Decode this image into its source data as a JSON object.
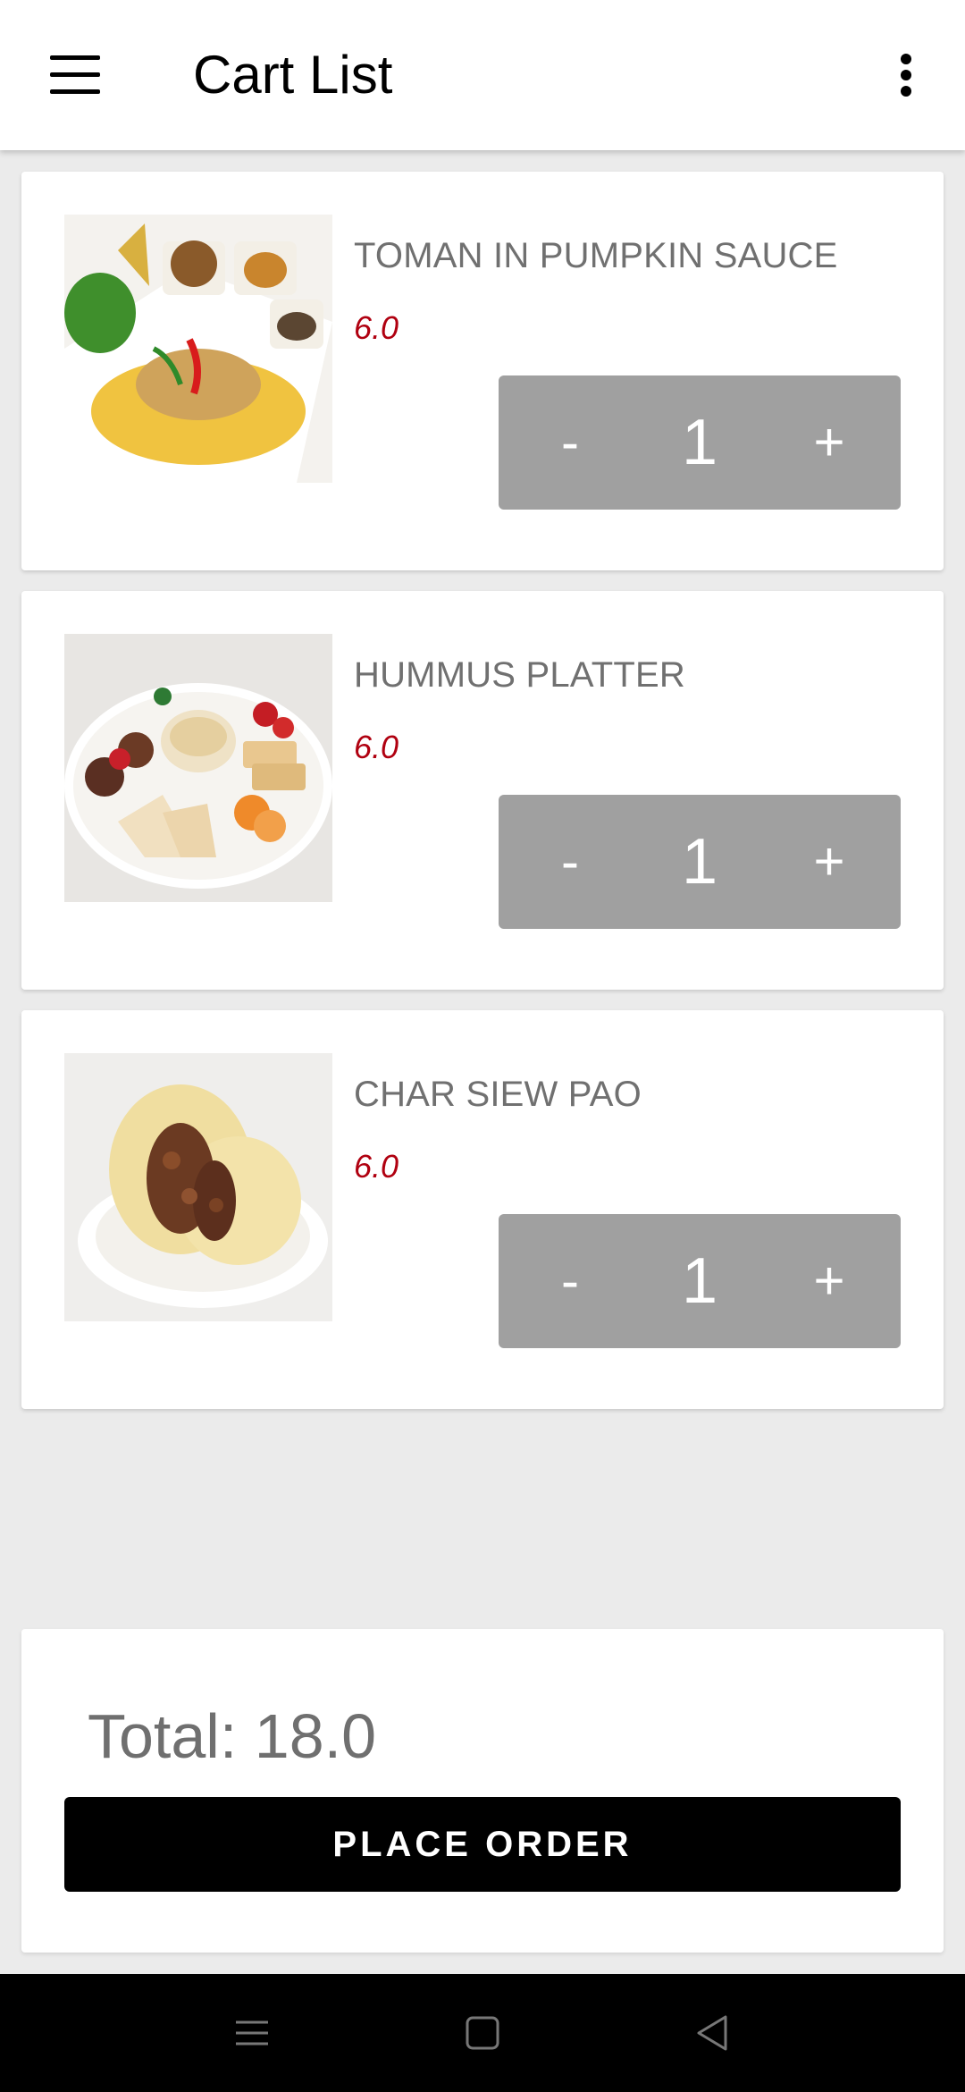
{
  "app_bar": {
    "title": "Cart List",
    "menu_icon": "hamburger-menu-icon",
    "overflow_icon": "more-vertical-icon"
  },
  "cart": {
    "items": [
      {
        "name": "TOMAN IN PUMPKIN SAUCE",
        "price": "6.0",
        "quantity": "1",
        "minus_label": "-",
        "plus_label": "+"
      },
      {
        "name": "HUMMUS PLATTER",
        "price": "6.0",
        "quantity": "1",
        "minus_label": "-",
        "plus_label": "+"
      },
      {
        "name": "CHAR SIEW PAO",
        "price": "6.0",
        "quantity": "1",
        "minus_label": "-",
        "plus_label": "+"
      }
    ]
  },
  "summary": {
    "total_text": "Total: 18.0",
    "place_order_label": "PLACE ORDER"
  },
  "nav_bar": {
    "icons": [
      "recents-icon",
      "home-icon",
      "back-icon"
    ]
  },
  "colors": {
    "price": "#b00010",
    "stepper": "#a0a0a0",
    "button": "#000000",
    "background": "#ebebeb"
  }
}
